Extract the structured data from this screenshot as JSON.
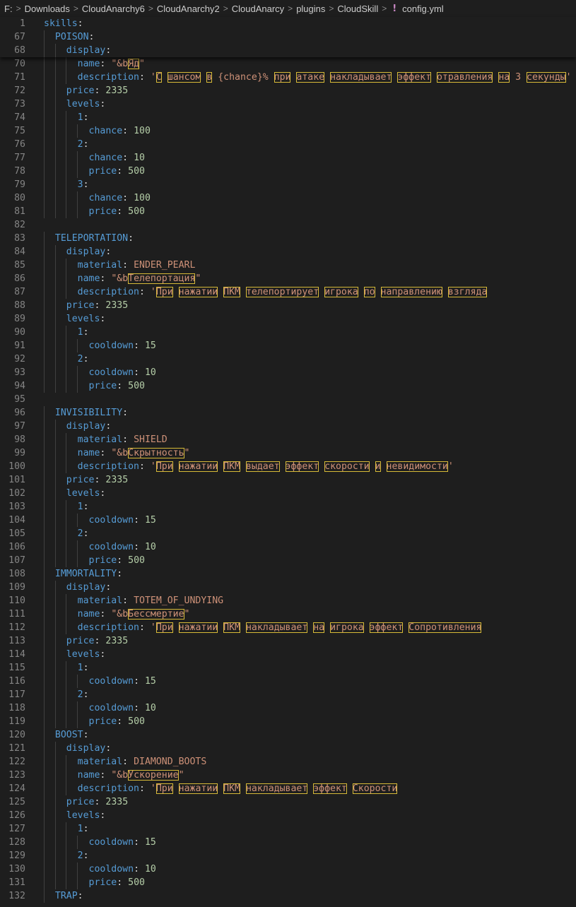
{
  "breadcrumb": {
    "items": [
      "F:",
      "Downloads",
      "CloudAnarchy6",
      "CloudAnarchy2",
      "CloudAnarcy",
      "plugins",
      "CloudSkill"
    ],
    "file": "config.yml",
    "file_icon": "!"
  },
  "colors": {
    "key": "#569cd6",
    "number": "#b5cea8",
    "string": "#ce9178",
    "highlight": "#d7ba38"
  },
  "sticky": [
    {
      "n": "1",
      "indent": 0,
      "key": "skills"
    },
    {
      "n": "67",
      "indent": 1,
      "key": "POISON"
    },
    {
      "n": "68",
      "indent": 2,
      "key": "display"
    }
  ],
  "lines": [
    {
      "n": "70",
      "indent": 3,
      "key": "name",
      "str": "\"&bЯд\"",
      "hl": [
        "Яд"
      ]
    },
    {
      "n": "71",
      "indent": 3,
      "key": "description",
      "str": "'С шансом в {chance}% при атаке накладывает эффект отравления на 3 секунды'",
      "hl": [
        "С",
        "шансом",
        "в",
        "при",
        "атаке",
        "накладывает",
        "эффект",
        "отравления",
        "на",
        "секунды"
      ]
    },
    {
      "n": "72",
      "indent": 2,
      "key": "price",
      "num": "2335"
    },
    {
      "n": "73",
      "indent": 2,
      "key": "levels"
    },
    {
      "n": "74",
      "indent": 3,
      "key": "1"
    },
    {
      "n": "75",
      "indent": 4,
      "key": "chance",
      "num": "100"
    },
    {
      "n": "76",
      "indent": 3,
      "key": "2"
    },
    {
      "n": "77",
      "indent": 4,
      "key": "chance",
      "num": "10"
    },
    {
      "n": "78",
      "indent": 4,
      "key": "price",
      "num": "500"
    },
    {
      "n": "79",
      "indent": 3,
      "key": "3"
    },
    {
      "n": "80",
      "indent": 4,
      "key": "chance",
      "num": "100"
    },
    {
      "n": "81",
      "indent": 4,
      "key": "price",
      "num": "500"
    },
    {
      "n": "82",
      "indent": 0
    },
    {
      "n": "83",
      "indent": 1,
      "key": "TELEPORTATION"
    },
    {
      "n": "84",
      "indent": 2,
      "key": "display"
    },
    {
      "n": "85",
      "indent": 3,
      "key": "material",
      "str": "ENDER_PEARL"
    },
    {
      "n": "86",
      "indent": 3,
      "key": "name",
      "str": "\"&bТелепортация\"",
      "hl": [
        "Телепортация"
      ]
    },
    {
      "n": "87",
      "indent": 3,
      "key": "description",
      "str": "'При нажатии ПКМ телепортирует игрока по направлению взгляда",
      "hl": [
        "При",
        "нажатии",
        "ПКМ",
        "телепортирует",
        "игрока",
        "по",
        "направлению",
        "взгляда"
      ]
    },
    {
      "n": "88",
      "indent": 2,
      "key": "price",
      "num": "2335"
    },
    {
      "n": "89",
      "indent": 2,
      "key": "levels"
    },
    {
      "n": "90",
      "indent": 3,
      "key": "1"
    },
    {
      "n": "91",
      "indent": 4,
      "key": "cooldown",
      "num": "15"
    },
    {
      "n": "92",
      "indent": 3,
      "key": "2"
    },
    {
      "n": "93",
      "indent": 4,
      "key": "cooldown",
      "num": "10"
    },
    {
      "n": "94",
      "indent": 4,
      "key": "price",
      "num": "500"
    },
    {
      "n": "95",
      "indent": 0
    },
    {
      "n": "96",
      "indent": 1,
      "key": "INVISIBILITY"
    },
    {
      "n": "97",
      "indent": 2,
      "key": "display"
    },
    {
      "n": "98",
      "indent": 3,
      "key": "material",
      "str": "SHIELD"
    },
    {
      "n": "99",
      "indent": 3,
      "key": "name",
      "str": "\"&bСкрытность\"",
      "hl": [
        "Скрытность"
      ]
    },
    {
      "n": "100",
      "indent": 3,
      "key": "description",
      "str": "'При нажатии ПКМ выдает эффект скорости и невидимости'",
      "hl": [
        "При",
        "нажатии",
        "ПКМ",
        "выдает",
        "эффект",
        "скорости",
        "и",
        "невидимости"
      ]
    },
    {
      "n": "101",
      "indent": 2,
      "key": "price",
      "num": "2335"
    },
    {
      "n": "102",
      "indent": 2,
      "key": "levels"
    },
    {
      "n": "103",
      "indent": 3,
      "key": "1"
    },
    {
      "n": "104",
      "indent": 4,
      "key": "cooldown",
      "num": "15"
    },
    {
      "n": "105",
      "indent": 3,
      "key": "2"
    },
    {
      "n": "106",
      "indent": 4,
      "key": "cooldown",
      "num": "10"
    },
    {
      "n": "107",
      "indent": 4,
      "key": "price",
      "num": "500"
    },
    {
      "n": "108",
      "indent": 1,
      "key": "IMMORTALITY"
    },
    {
      "n": "109",
      "indent": 2,
      "key": "display"
    },
    {
      "n": "110",
      "indent": 3,
      "key": "material",
      "str": "TOTEM_OF_UNDYING"
    },
    {
      "n": "111",
      "indent": 3,
      "key": "name",
      "str": "\"&bБессмертие\"",
      "hl": [
        "Бессмертие"
      ]
    },
    {
      "n": "112",
      "indent": 3,
      "key": "description",
      "str": "'При нажатии ПКМ накладывает на игрока эффект Сопротивления",
      "hl": [
        "При",
        "нажатии",
        "ПКМ",
        "накладывает",
        "на",
        "игрока",
        "эффект",
        "Сопротивления"
      ]
    },
    {
      "n": "113",
      "indent": 2,
      "key": "price",
      "num": "2335"
    },
    {
      "n": "114",
      "indent": 2,
      "key": "levels"
    },
    {
      "n": "115",
      "indent": 3,
      "key": "1"
    },
    {
      "n": "116",
      "indent": 4,
      "key": "cooldown",
      "num": "15"
    },
    {
      "n": "117",
      "indent": 3,
      "key": "2"
    },
    {
      "n": "118",
      "indent": 4,
      "key": "cooldown",
      "num": "10"
    },
    {
      "n": "119",
      "indent": 4,
      "key": "price",
      "num": "500"
    },
    {
      "n": "120",
      "indent": 1,
      "key": "BOOST"
    },
    {
      "n": "121",
      "indent": 2,
      "key": "display"
    },
    {
      "n": "122",
      "indent": 3,
      "key": "material",
      "str": "DIAMOND_BOOTS"
    },
    {
      "n": "123",
      "indent": 3,
      "key": "name",
      "str": "\"&bУскорение\"",
      "hl": [
        "Ускорение"
      ]
    },
    {
      "n": "124",
      "indent": 3,
      "key": "description",
      "str": "'При нажатии ПКМ накладывает эффект Скорости",
      "hl": [
        "При",
        "нажатии",
        "ПКМ",
        "накладывает",
        "эффект",
        "Скорости"
      ]
    },
    {
      "n": "125",
      "indent": 2,
      "key": "price",
      "num": "2335"
    },
    {
      "n": "126",
      "indent": 2,
      "key": "levels"
    },
    {
      "n": "127",
      "indent": 3,
      "key": "1"
    },
    {
      "n": "128",
      "indent": 4,
      "key": "cooldown",
      "num": "15"
    },
    {
      "n": "129",
      "indent": 3,
      "key": "2"
    },
    {
      "n": "130",
      "indent": 4,
      "key": "cooldown",
      "num": "10"
    },
    {
      "n": "131",
      "indent": 4,
      "key": "price",
      "num": "500"
    },
    {
      "n": "132",
      "indent": 1,
      "key": "TRAP"
    }
  ]
}
